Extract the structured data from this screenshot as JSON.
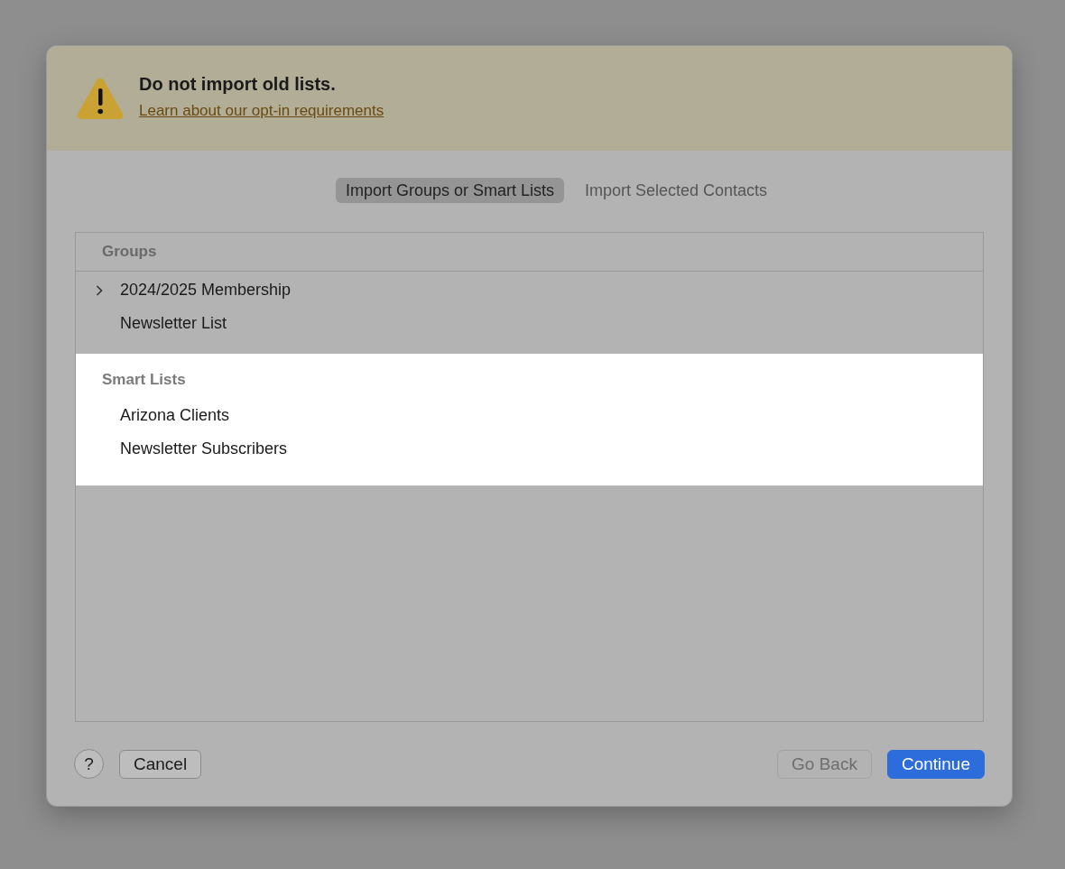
{
  "banner": {
    "title": "Do not import old lists.",
    "link": "Learn about our opt-in requirements"
  },
  "tabs": [
    {
      "label": "Import Groups or Smart Lists",
      "selected": true
    },
    {
      "label": "Import Selected Contacts",
      "selected": false
    }
  ],
  "sections": [
    {
      "heading": "Groups",
      "highlighted": false,
      "items": [
        {
          "label": "2024/2025 Membership",
          "expanded": false
        },
        {
          "label": "Newsletter List"
        }
      ]
    },
    {
      "heading": "Smart Lists",
      "highlighted": true,
      "items": [
        {
          "label": "Arizona Clients"
        },
        {
          "label": "Newsletter Subscribers"
        }
      ]
    }
  ],
  "left_buttons": [
    {
      "label": "?",
      "kind": "help",
      "disabled": false
    },
    {
      "label": "Cancel",
      "kind": "normal",
      "disabled": false
    }
  ],
  "right_buttons": [
    {
      "label": "Go Back",
      "kind": "normal",
      "disabled": true
    },
    {
      "label": "Continue",
      "kind": "primary",
      "disabled": false
    }
  ]
}
